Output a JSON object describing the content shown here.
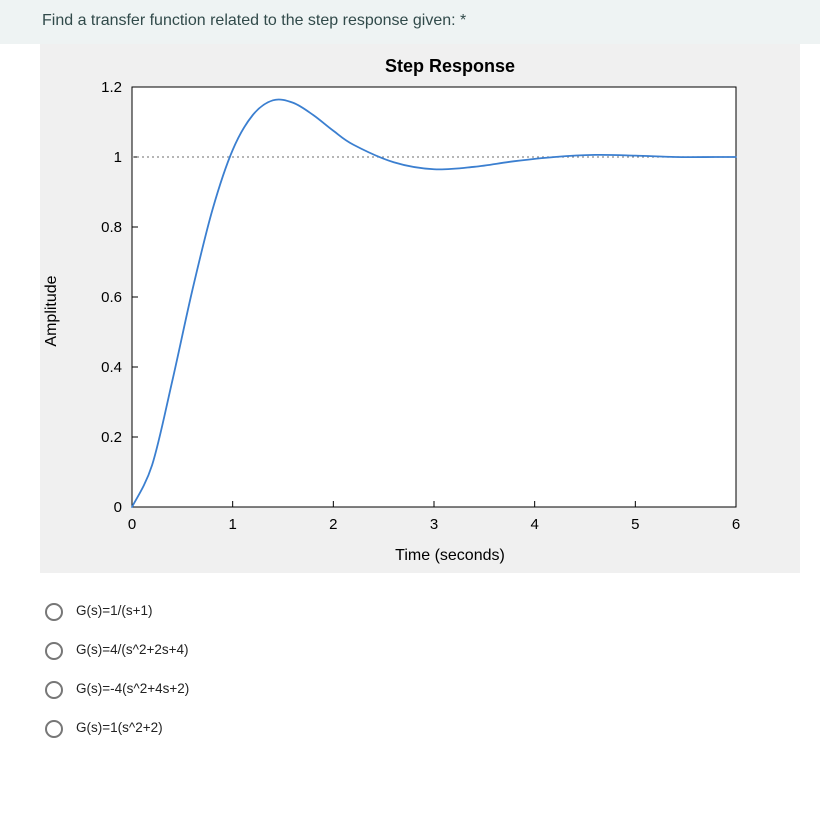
{
  "question": "Find a transfer function related to the step response given: *",
  "chart_data": {
    "type": "line",
    "title": "Step Response",
    "xlabel": "Time (seconds)",
    "ylabel": "Amplitude",
    "xlim": [
      0,
      6
    ],
    "ylim": [
      0,
      1.2
    ],
    "xticks": [
      0,
      1,
      2,
      3,
      4,
      5,
      6
    ],
    "yticks": [
      0,
      0.2,
      0.4,
      0.6,
      0.8,
      1,
      1.2
    ],
    "reference_line_y": 1.0,
    "series": [
      {
        "name": "step response",
        "x": [
          0,
          0.2,
          0.4,
          0.6,
          0.8,
          1.0,
          1.2,
          1.4,
          1.6,
          1.8,
          2.0,
          2.2,
          2.6,
          3.0,
          3.4,
          3.8,
          4.2,
          4.6,
          5.0,
          5.4,
          5.8,
          6.0
        ],
        "y": [
          0,
          0.12,
          0.36,
          0.62,
          0.85,
          1.02,
          1.12,
          1.162,
          1.155,
          1.12,
          1.075,
          1.035,
          0.985,
          0.965,
          0.972,
          0.988,
          1.0,
          1.006,
          1.004,
          1.0,
          1.0,
          1.0
        ]
      }
    ]
  },
  "options": [
    {
      "label": "G(s)=1/(s+1)"
    },
    {
      "label": "G(s)=4/(s^2+2s+4)"
    },
    {
      "label": "G(s)=-4(s^2+4s+2)"
    },
    {
      "label": "G(s)=1(s^2+2)"
    }
  ]
}
